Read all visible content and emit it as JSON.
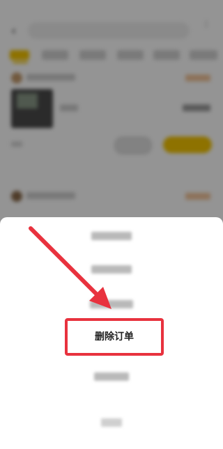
{
  "sheet": {
    "delete_order_label": "删除订单"
  },
  "colors": {
    "accent_yellow": "#f4c400",
    "highlight_red": "#e8323e",
    "status_orange": "#f2c59a"
  },
  "icons": {
    "back": "chevron-left-icon",
    "more": "more-icon",
    "arrow": "red-arrow-annotation"
  }
}
